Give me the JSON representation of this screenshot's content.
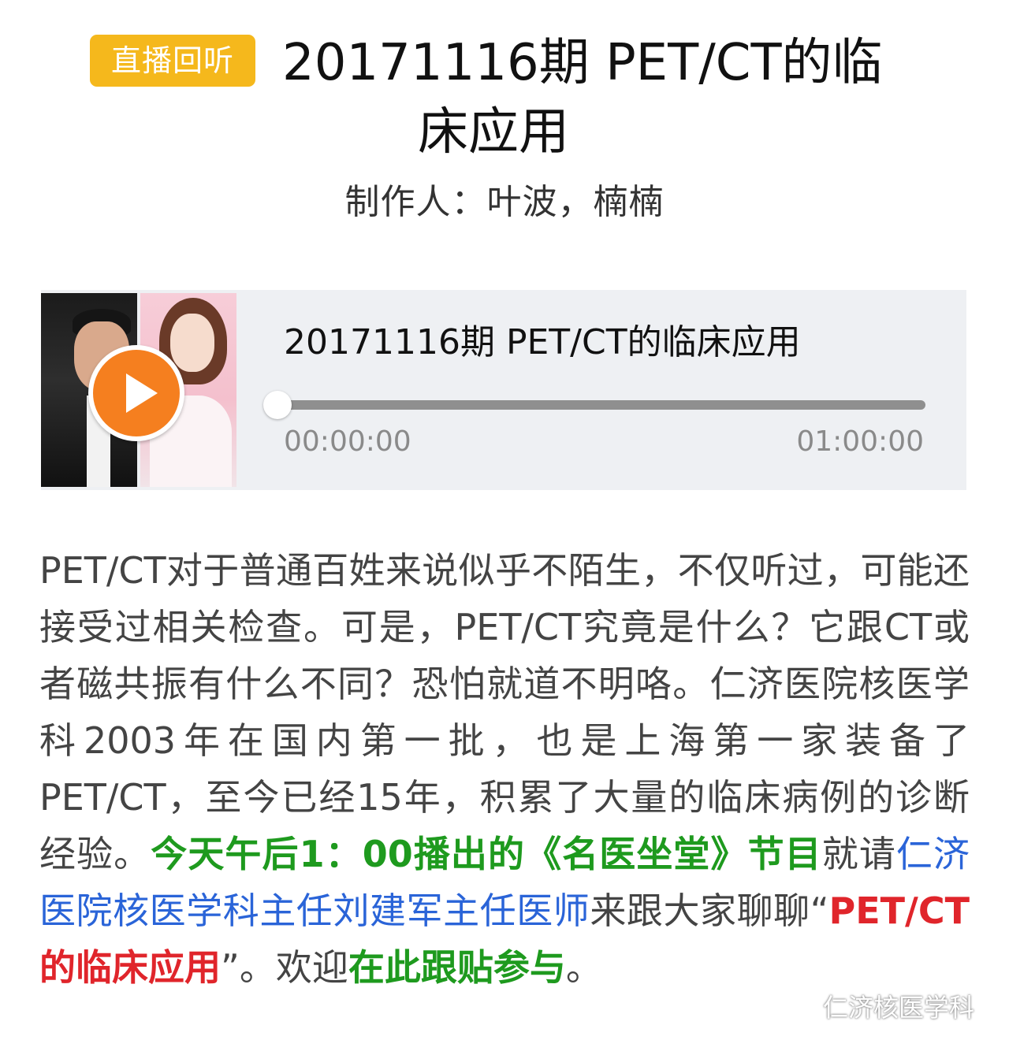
{
  "header": {
    "badge": "直播回听",
    "title_line1": "20171116期 PET/CT的临",
    "title_line2": "床应用",
    "producer": "制作人：叶波，楠楠"
  },
  "player": {
    "track_title": "20171116期 PET/CT的临床应用",
    "time_current": "00:00:00",
    "time_total": "01:00:00",
    "progress": 0
  },
  "article": {
    "p1": "PET/CT对于普通百姓来说似乎不陌生，不仅听过，可能还接受过相关检查。可是，PET/CT究竟是什么？它跟CT或者磁共振有什么不同？恐怕就道不明咯。仁济医院核医学科2003年在国内第一批，也是上海第一家装备了PET/CT，至今已经15年，积累了大量的临床病例的诊断经验。",
    "green1": "今天午后1：00播出的《名医坐堂》节目",
    "p2": "就请",
    "blue1": "仁济医院核医学科主任刘建军主任医师",
    "p3": "来跟大家聊聊“",
    "red1": "PET/CT的临床应用",
    "p4": "”。欢迎",
    "green2": "在此跟贴参与",
    "p5": "。"
  },
  "watermark": "仁济核医学科"
}
